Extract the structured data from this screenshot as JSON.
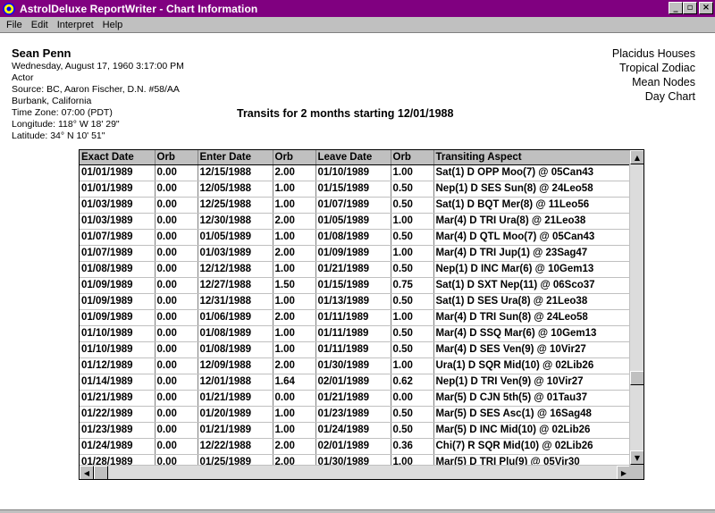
{
  "window": {
    "title": "AstrolDeluxe ReportWriter - Chart Information",
    "buttons": {
      "minimize": "_",
      "maximize": "▫",
      "close": "×"
    }
  },
  "menu": [
    {
      "label": "File"
    },
    {
      "label": "Edit"
    },
    {
      "label": "Interpret"
    },
    {
      "label": "Help"
    }
  ],
  "chart": {
    "name": "Sean Penn",
    "lines": [
      "Wednesday, August 17, 1960 3:17:00 PM",
      "Actor",
      "Source: BC, Aaron Fischer, D.N. #58/AA",
      "Burbank, California",
      "Time Zone: 07:00 (PDT)",
      "Longitude: 118° W 18' 29\"",
      "Latitude: 34° N 10' 51\""
    ],
    "settings": [
      "Placidus Houses",
      "Tropical Zodiac",
      "Mean Nodes",
      "Day Chart"
    ]
  },
  "report": {
    "title": "Transits for 2 months starting 12/01/1988"
  },
  "table": {
    "columns": [
      "Exact Date",
      "Orb",
      "Enter Date",
      "Orb",
      "Leave Date",
      "Orb",
      "Transiting Aspect"
    ],
    "rows": [
      [
        "01/01/1989",
        "0.00",
        "12/15/1988",
        "2.00",
        "01/10/1989",
        "1.00",
        "Sat(1) D OPP Moo(7) @ 05Can43"
      ],
      [
        "01/01/1989",
        "0.00",
        "12/05/1988",
        "1.00",
        "01/15/1989",
        "0.50",
        "Nep(1) D SES Sun(8) @ 24Leo58"
      ],
      [
        "01/03/1989",
        "0.00",
        "12/25/1988",
        "1.00",
        "01/07/1989",
        "0.50",
        "Sat(1) D BQT Mer(8) @ 11Leo56"
      ],
      [
        "01/03/1989",
        "0.00",
        "12/30/1988",
        "2.00",
        "01/05/1989",
        "1.00",
        "Mar(4) D TRI Ura(8) @ 21Leo38"
      ],
      [
        "01/07/1989",
        "0.00",
        "01/05/1989",
        "1.00",
        "01/08/1989",
        "0.50",
        "Mar(4) D QTL Moo(7) @ 05Can43"
      ],
      [
        "01/07/1989",
        "0.00",
        "01/03/1989",
        "2.00",
        "01/09/1989",
        "1.00",
        "Mar(4) D TRI Jup(1) @ 23Sag47"
      ],
      [
        "01/08/1989",
        "0.00",
        "12/12/1988",
        "1.00",
        "01/21/1989",
        "0.50",
        "Nep(1) D INC Mar(6) @ 10Gem13"
      ],
      [
        "01/09/1989",
        "0.00",
        "12/27/1988",
        "1.50",
        "01/15/1989",
        "0.75",
        "Sat(1) D SXT Nep(11) @ 06Sco37"
      ],
      [
        "01/09/1989",
        "0.00",
        "12/31/1988",
        "1.00",
        "01/13/1989",
        "0.50",
        "Sat(1) D SES Ura(8) @ 21Leo38"
      ],
      [
        "01/09/1989",
        "0.00",
        "01/06/1989",
        "2.00",
        "01/11/1989",
        "1.00",
        "Mar(4) D TRI Sun(8) @ 24Leo58"
      ],
      [
        "01/10/1989",
        "0.00",
        "01/08/1989",
        "1.00",
        "01/11/1989",
        "0.50",
        "Mar(4) D SSQ Mar(6) @ 10Gem13"
      ],
      [
        "01/10/1989",
        "0.00",
        "01/08/1989",
        "1.00",
        "01/11/1989",
        "0.50",
        "Mar(4) D SES Ven(9) @ 10Vir27"
      ],
      [
        "01/12/1989",
        "0.00",
        "12/09/1988",
        "2.00",
        "01/30/1989",
        "1.00",
        "Ura(1) D SQR Mid(10) @ 02Lib26"
      ],
      [
        "01/14/1989",
        "0.00",
        "12/01/1988",
        "1.64",
        "02/01/1989",
        "0.62",
        "Nep(1) D TRI Ven(9) @ 10Vir27"
      ],
      [
        "01/21/1989",
        "0.00",
        "01/21/1989",
        "0.00",
        "01/21/1989",
        "0.00",
        "Mar(5) D CJN 5th(5) @ 01Tau37"
      ],
      [
        "01/22/1989",
        "0.00",
        "01/20/1989",
        "1.00",
        "01/23/1989",
        "0.50",
        "Mar(5) D SES Asc(1) @ 16Sag48"
      ],
      [
        "01/23/1989",
        "0.00",
        "01/21/1989",
        "1.00",
        "01/24/1989",
        "0.50",
        "Mar(5) D INC Mid(10) @ 02Lib26"
      ],
      [
        "01/24/1989",
        "0.00",
        "12/22/1988",
        "2.00",
        "02/01/1989",
        "0.36",
        "Chi(7) R SQR Mid(10) @ 02Lib26"
      ],
      [
        "01/28/1989",
        "0.00",
        "01/25/1989",
        "2.00",
        "01/30/1989",
        "1.00",
        "Mar(5) D TRI Plu(9) @ 05Vir30"
      ]
    ]
  },
  "scroll": {
    "vertical_position": 0.76
  },
  "icons": {
    "app": "astrology-app-icon",
    "up": "arrow-up-icon",
    "down": "arrow-down-icon",
    "left": "arrow-left-icon",
    "right": "arrow-right-icon"
  }
}
